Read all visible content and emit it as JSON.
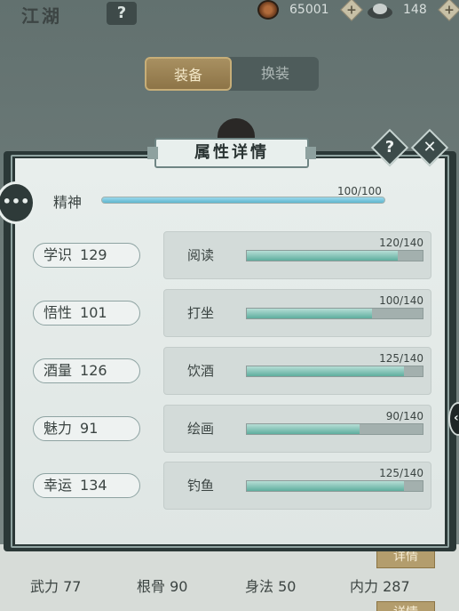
{
  "topbar": {
    "location": "江湖",
    "help": "?",
    "coins": "65001",
    "ingots": "148",
    "plus": "+"
  },
  "tabs": [
    {
      "label": "装备",
      "active": true
    },
    {
      "label": "换装",
      "active": false
    }
  ],
  "dialog": {
    "title": "属性详情",
    "help": "?",
    "close": "✕",
    "spirit": {
      "label": "精神",
      "value": "100/100",
      "fraction": 1.0
    },
    "attributes": [
      {
        "name": "学识",
        "value": "129"
      },
      {
        "name": "悟性",
        "value": "101"
      },
      {
        "name": "酒量",
        "value": "126"
      },
      {
        "name": "魅力",
        "value": "91"
      },
      {
        "name": "幸运",
        "value": "134"
      }
    ],
    "skills": [
      {
        "name": "阅读",
        "value": "120/140",
        "fraction": 0.857
      },
      {
        "name": "打坐",
        "value": "100/140",
        "fraction": 0.714
      },
      {
        "name": "饮酒",
        "value": "125/140",
        "fraction": 0.893
      },
      {
        "name": "绘画",
        "value": "90/140",
        "fraction": 0.643
      },
      {
        "name": "钓鱼",
        "value": "125/140",
        "fraction": 0.893
      }
    ]
  },
  "under": {
    "stats": [
      {
        "label": "武力 77"
      },
      {
        "label": "根骨 90"
      },
      {
        "label": "身法 50"
      },
      {
        "label": "内力 287"
      }
    ],
    "detail_label": "详情"
  },
  "colors": {
    "accent_gold": "#a89061",
    "spirit_fill": "#5fb6cf",
    "skill_fill": "#5eae9e",
    "panel_bg": "#e8eeec"
  }
}
